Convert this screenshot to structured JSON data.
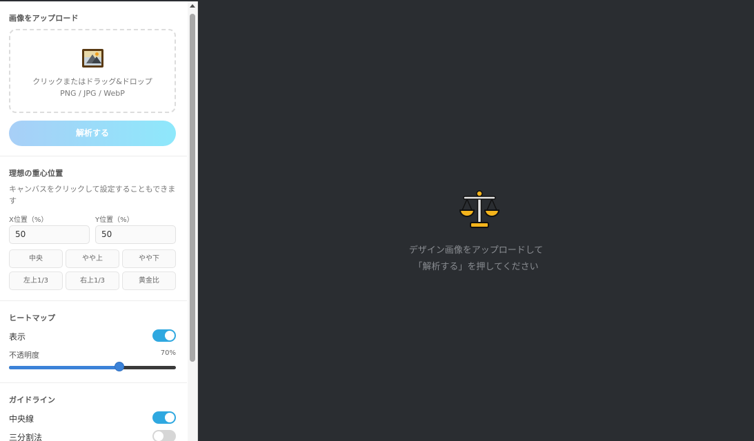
{
  "upload": {
    "title": "画像をアップロード",
    "icon": "framed-picture-icon",
    "line1": "クリックまたはドラッグ&ドロップ",
    "line2": "PNG / JPG / WebP",
    "analyze_label": "解析する",
    "analyze_gradient": [
      "#a8cff7",
      "#8ee8fb"
    ]
  },
  "ideal": {
    "title": "理想の重心位置",
    "hint": "キャンバスをクリックして設定することもできます",
    "x_label": "X位置（%）",
    "y_label": "Y位置（%）",
    "x_value": "50",
    "y_value": "50",
    "presets": [
      "中央",
      "やや上",
      "やや下",
      "左上1/3",
      "右上1/3",
      "黄金比"
    ]
  },
  "heatmap": {
    "title": "ヒートマップ",
    "show_label": "表示",
    "show_on": true,
    "opacity_label": "不透明度",
    "opacity_value": "70%",
    "opacity_fraction": 0.66
  },
  "guides": {
    "title": "ガイドライン",
    "center_label": "中央線",
    "center_on": true,
    "thirds_label": "三分割法",
    "thirds_on": false
  },
  "main": {
    "icon": "balance-scale-icon",
    "line1": "デザイン画像をアップロードして",
    "line2": "「解析する」を押してください"
  },
  "colors": {
    "toggle_on": "#2fa8e0",
    "slider": "#3b82d8",
    "canvas_bg": "#2a2d31"
  }
}
